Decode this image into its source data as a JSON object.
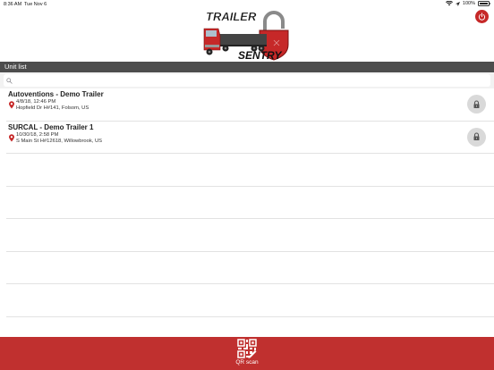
{
  "status_bar": {
    "time": "8:36 AM",
    "date": "Tue Nov 6",
    "battery": "100%",
    "battery_level": 1.0
  },
  "header": {
    "logo_text_top": "TRAILER",
    "logo_text_bottom": "SENTRY",
    "power_icon": "power-icon",
    "brand_color": "#c62828"
  },
  "section": {
    "title": "Unit list"
  },
  "search": {
    "placeholder": "",
    "value": ""
  },
  "units": [
    {
      "name": "Autoventions - Demo Trailer",
      "timestamp": "4/8/18, 12:46 PM",
      "address": "Hopfield Dr H#141, Folsom, US",
      "status_icon": "lock-icon"
    },
    {
      "name": "SURCAL - Demo Trailer 1",
      "timestamp": "10/30/18, 2:58 PM",
      "address": "S Main St H#12618, Willowbrook, US",
      "status_icon": "lock-icon"
    }
  ],
  "bottom_bar": {
    "qr_label": "QR scan",
    "bar_color": "#c0302f"
  }
}
